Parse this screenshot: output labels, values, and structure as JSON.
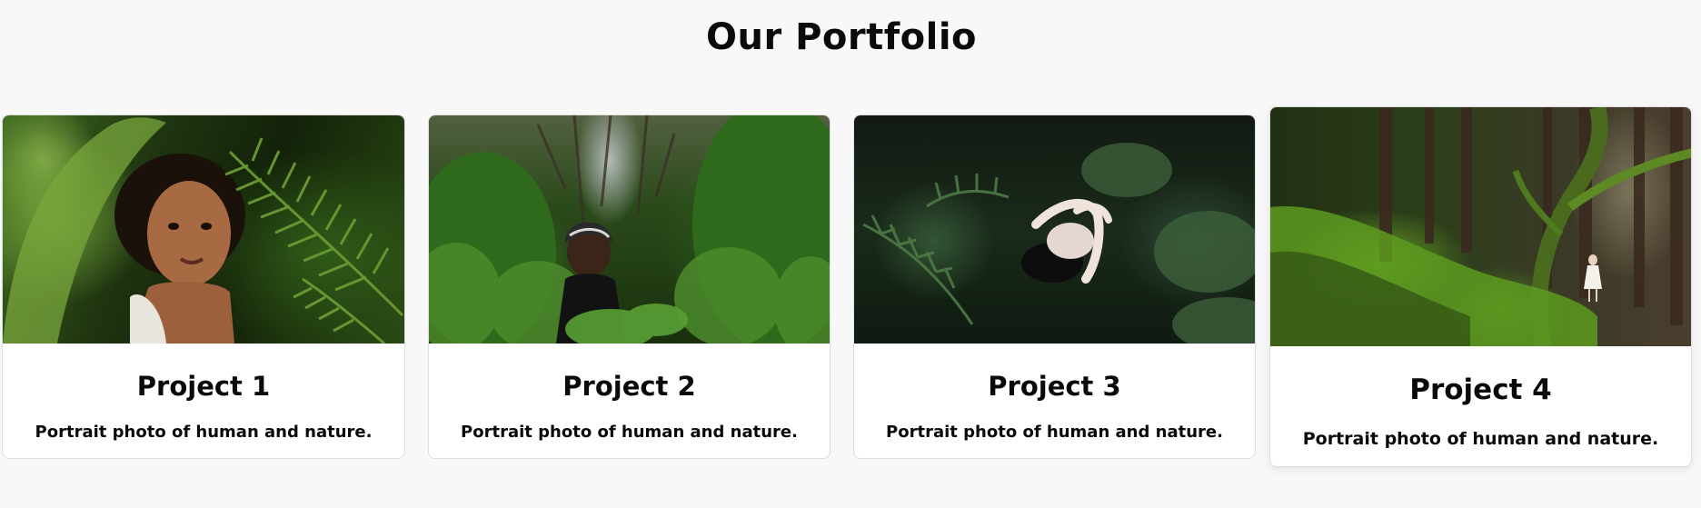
{
  "section": {
    "title": "Our Portfolio"
  },
  "projects": [
    {
      "title": "Project 1",
      "description": "Portrait photo of human and nature.",
      "photo_icon": "portrait-in-ferns-photo"
    },
    {
      "title": "Project 2",
      "description": "Portrait photo of human and nature.",
      "photo_icon": "portrait-in-bushes-photo"
    },
    {
      "title": "Project 3",
      "description": "Portrait photo of human and nature.",
      "photo_icon": "portrait-lying-in-foliage-photo"
    },
    {
      "title": "Project 4",
      "description": "Portrait photo of human and nature.",
      "photo_icon": "girl-in-mossy-forest-photo"
    }
  ],
  "colors": {
    "page_background": "#f8f8f8",
    "card_background": "#ffffff",
    "text": "#0a0a0a"
  }
}
